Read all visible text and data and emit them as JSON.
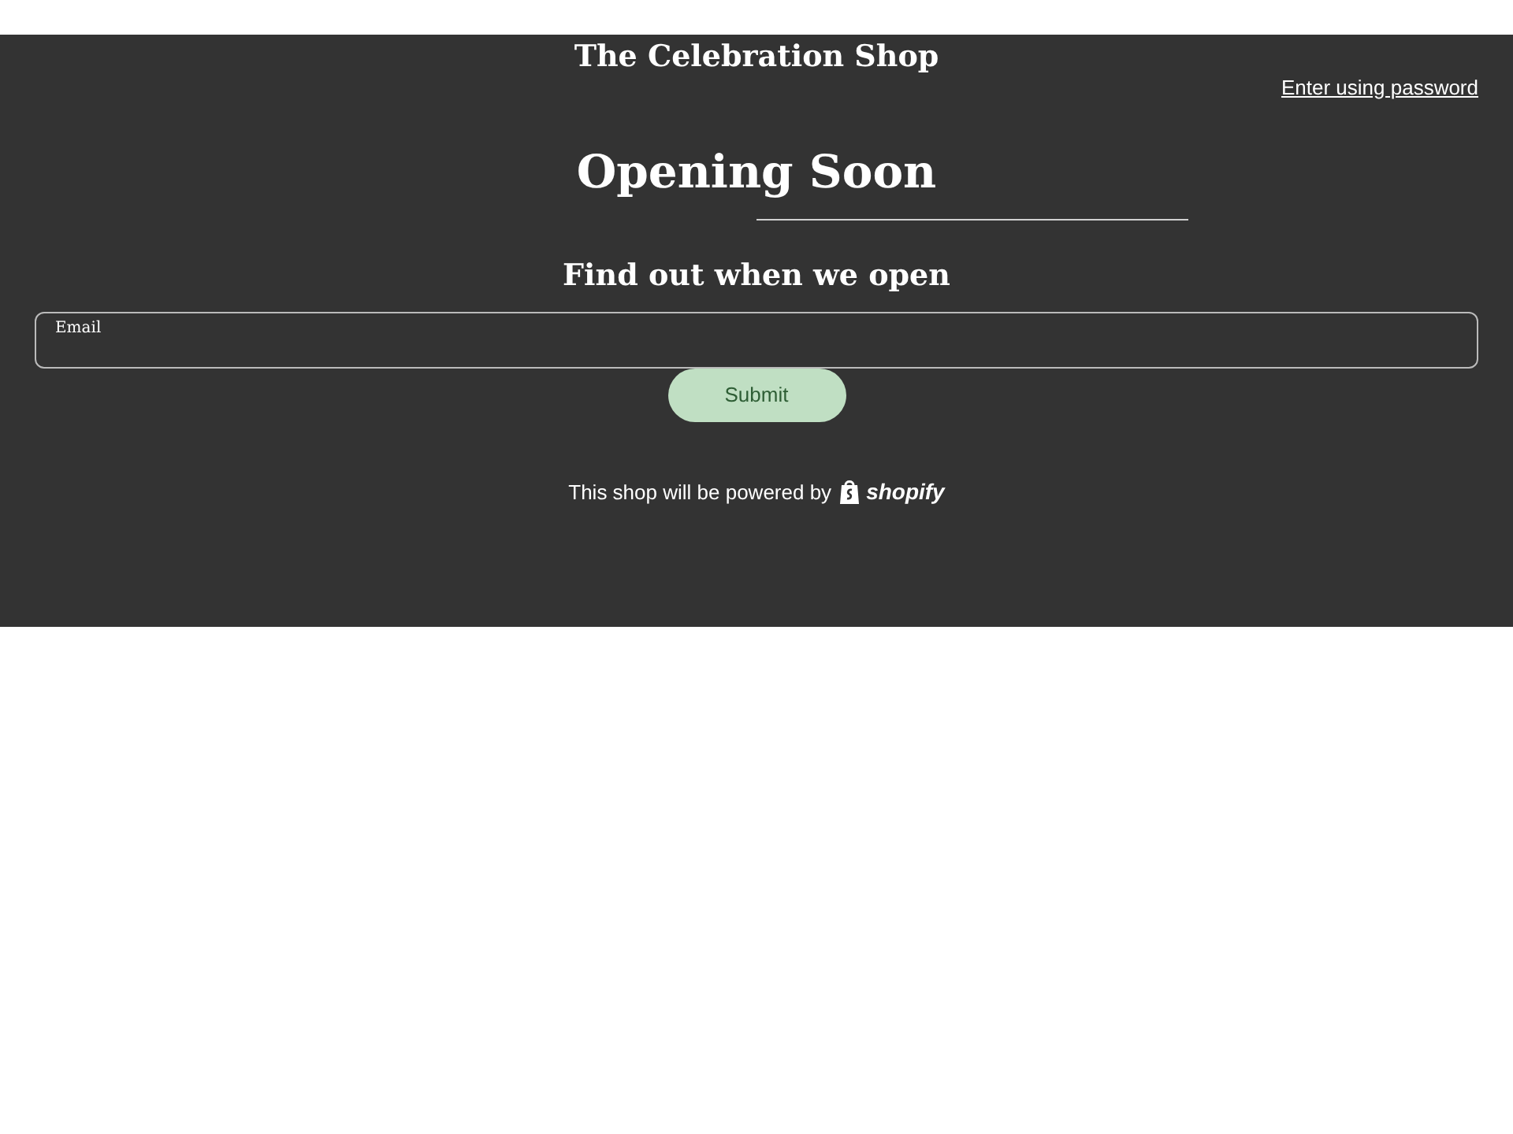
{
  "shop_name": "The Celebration Shop",
  "password_link": "Enter using password",
  "heading": "Opening Soon",
  "subheading": "Find out when we open",
  "email_field": {
    "label": "Email"
  },
  "submit_button": "Submit",
  "footer": {
    "text": "This shop will be powered by",
    "brand": "shopify"
  }
}
